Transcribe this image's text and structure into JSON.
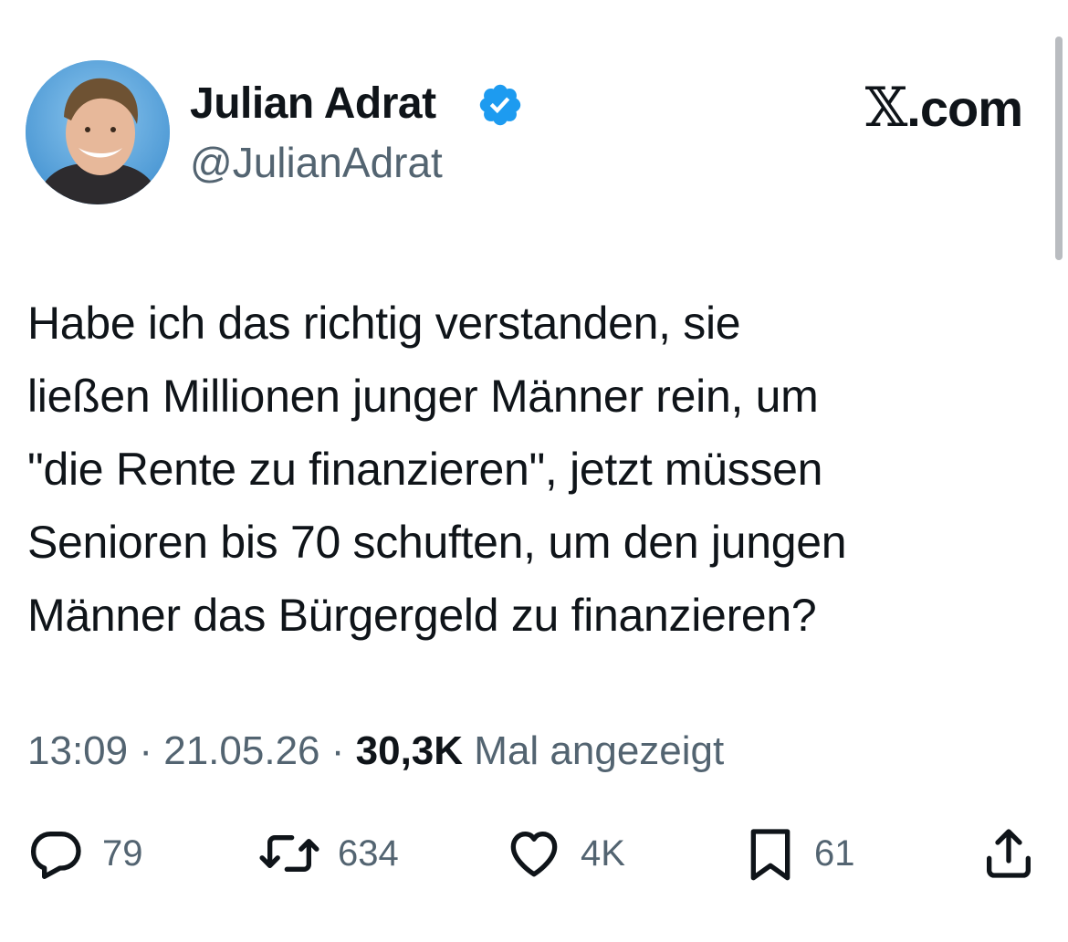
{
  "author": {
    "name": "Julian Adrat",
    "handle": "@JulianAdrat",
    "verified_icon": "verified-badge-icon",
    "verified_color": "#1d9bf0"
  },
  "brand": {
    "mark": "𝕏",
    "suffix": ".com"
  },
  "tweet": {
    "text": "Habe ich das richtig verstanden, sie\nließen Millionen junger Männer rein, um\n\"die Rente zu finanzieren\", jetzt müssen\nSenioren bis 70 schuften, um den jungen\nMänner das Bürgergeld zu finanzieren?"
  },
  "meta": {
    "time": "13:09",
    "separator": "·",
    "date": "21.05.26",
    "views_count": "30,3K",
    "views_label": "Mal angezeigt"
  },
  "actions": {
    "replies": {
      "icon": "reply-icon",
      "count": "79"
    },
    "reposts": {
      "icon": "repost-icon",
      "count": "634"
    },
    "likes": {
      "icon": "heart-icon",
      "count": "4K"
    },
    "bookmarks": {
      "icon": "bookmark-icon",
      "count": "61"
    },
    "share": {
      "icon": "share-icon"
    }
  },
  "colors": {
    "text": "#0f1419",
    "secondary": "#536471",
    "accent": "#1d9bf0"
  }
}
